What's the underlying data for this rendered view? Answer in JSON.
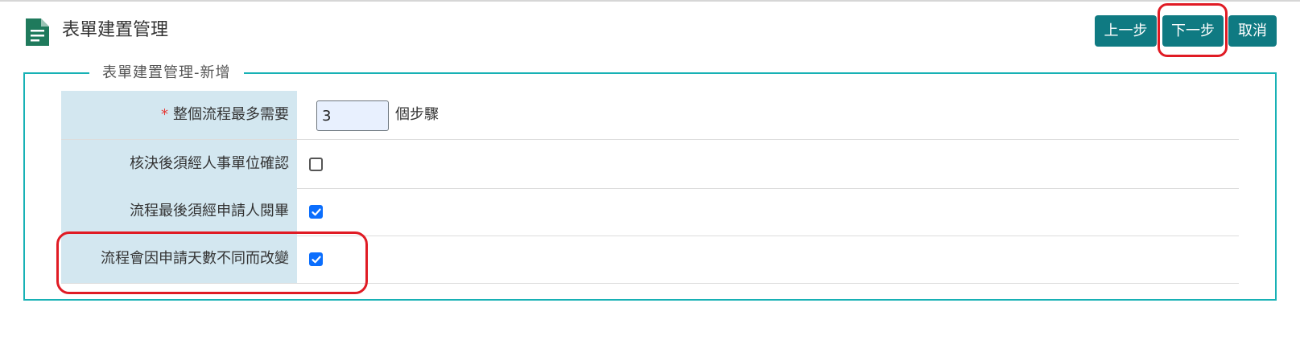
{
  "header": {
    "title": "表單建置管理",
    "icon": "document-icon"
  },
  "toolbar": {
    "prev_label": "上一步",
    "next_label": "下一步",
    "cancel_label": "取消"
  },
  "form": {
    "legend": "表單建置管理-新增",
    "max_steps": {
      "required_mark": "*",
      "label": "整個流程最多需要",
      "value": "3",
      "unit": "個步驟"
    },
    "rows": [
      {
        "label": "核決後須經人事單位確認",
        "checked": false
      },
      {
        "label": "流程最後須經申請人閱畢",
        "checked": true
      },
      {
        "label": "流程會因申請天數不同而改變",
        "checked": true
      }
    ]
  },
  "colors": {
    "accent": "#0f7a82",
    "fieldset_border": "#17b1b5",
    "label_background": "#d3e7f0",
    "highlight": "#e01b24",
    "checkbox_checked": "#0b6efd"
  }
}
